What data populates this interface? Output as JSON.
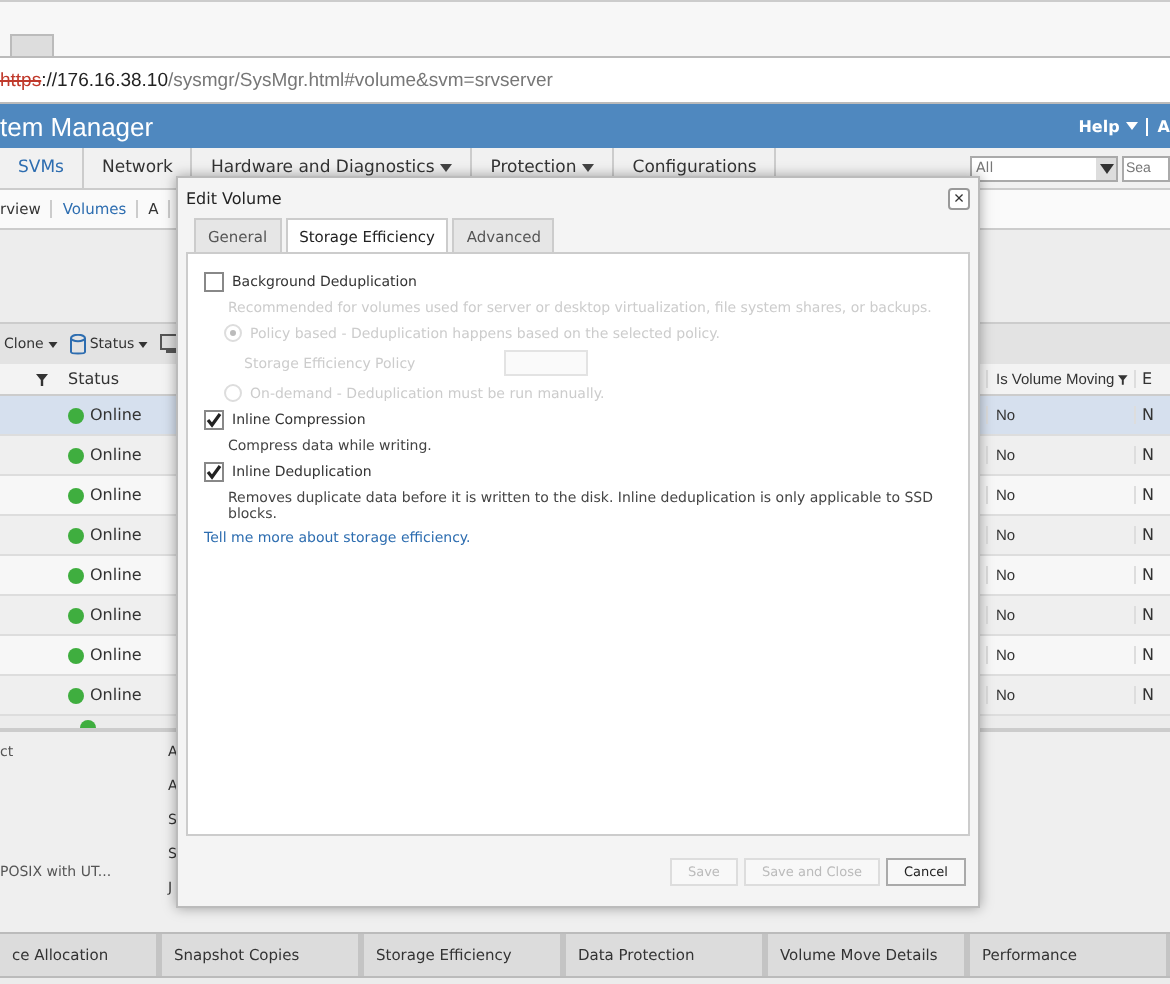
{
  "browser": {
    "url_scheme": "https",
    "url_rest": "://176.16.38.10",
    "url_path": "/sysmgr/SysMgr.html#volume&svm=srvserver"
  },
  "header": {
    "title": "tem Manager",
    "help": "Help",
    "user": "A"
  },
  "nav": [
    {
      "label": "SVMs",
      "selected": true,
      "has_menu": false
    },
    {
      "label": "Network",
      "selected": false,
      "has_menu": false
    },
    {
      "label": "Hardware and Diagnostics",
      "selected": false,
      "has_menu": true
    },
    {
      "label": "Protection",
      "selected": false,
      "has_menu": true
    },
    {
      "label": "Configurations",
      "selected": false,
      "has_menu": false
    }
  ],
  "filter_select": {
    "value": "All"
  },
  "search": {
    "placeholder": "Sea"
  },
  "subnav": [
    {
      "label": "rview",
      "selected": false
    },
    {
      "label": "Volumes",
      "selected": true
    },
    {
      "label": "A",
      "selected": false
    }
  ],
  "toolbar": [
    {
      "kind": "menu",
      "label": "Clone"
    },
    {
      "kind": "icon-menu",
      "label": "Status"
    },
    {
      "kind": "icon"
    }
  ],
  "table": {
    "columns": [
      {
        "label": "Status"
      },
      {
        "label": "Is Volume Moving"
      },
      {
        "label": "E"
      }
    ],
    "rows": [
      {
        "status": "Online",
        "moving": "No",
        "column_3": "N",
        "selected": true
      },
      {
        "status": "Online",
        "moving": "No",
        "column_3": "N",
        "selected": false
      },
      {
        "status": "Online",
        "moving": "No",
        "column_3": "N",
        "selected": false
      },
      {
        "status": "Online",
        "moving": "No",
        "column_3": "N",
        "selected": false
      },
      {
        "status": "Online",
        "moving": "No",
        "column_3": "N",
        "selected": false
      },
      {
        "status": "Online",
        "moving": "No",
        "column_3": "N",
        "selected": false
      },
      {
        "status": "Online",
        "moving": "No",
        "column_3": "N",
        "selected": false
      },
      {
        "status": "Online",
        "moving": "No",
        "column_3": "N",
        "selected": false
      }
    ]
  },
  "details": {
    "values": [
      "ct",
      "POSIX with UT..."
    ],
    "labels": [
      "A",
      "A",
      "S",
      "S",
      "J"
    ]
  },
  "bottom_tabs": [
    "ce Allocation",
    "Snapshot Copies",
    "Storage Efficiency",
    "Data Protection",
    "Volume Move Details",
    "Performance"
  ],
  "dialog": {
    "title": "Edit Volume",
    "close": "×",
    "tabs": [
      {
        "label": "General",
        "selected": false
      },
      {
        "label": "Storage Efficiency",
        "selected": true
      },
      {
        "label": "Advanced",
        "selected": false
      }
    ],
    "options": [
      {
        "kind": "checkbox",
        "label": "Background Deduplication",
        "checked": false,
        "disabled": false
      },
      {
        "kind": "note",
        "text": "Recommended for volumes used for server or desktop virtualization, file system shares, or backups.",
        "disabled": true
      },
      {
        "kind": "radio",
        "label": "Policy based - Deduplication happens based on the selected policy.",
        "checked": true,
        "disabled": true
      },
      {
        "kind": "select",
        "label": "Storage Efficiency Policy",
        "disabled": true
      },
      {
        "kind": "radio",
        "label": "On-demand - Deduplication must be run manually.",
        "checked": false,
        "disabled": true
      },
      {
        "kind": "checkbox",
        "label": "Inline Compression",
        "checked": true,
        "disabled": false
      },
      {
        "kind": "note",
        "text": "Compress data while writing.",
        "disabled": false
      },
      {
        "kind": "checkbox",
        "label": "Inline Deduplication",
        "checked": true,
        "disabled": false
      },
      {
        "kind": "note",
        "text": "Removes duplicate data before it is written to the disk. Inline deduplication is only applicable to SSD blocks.",
        "disabled": false
      }
    ],
    "link": "Tell me more about storage efficiency.",
    "buttons": [
      {
        "label": "Save",
        "disabled": true
      },
      {
        "label": "Save and Close",
        "disabled": true
      },
      {
        "label": "Cancel",
        "disabled": false
      }
    ]
  }
}
